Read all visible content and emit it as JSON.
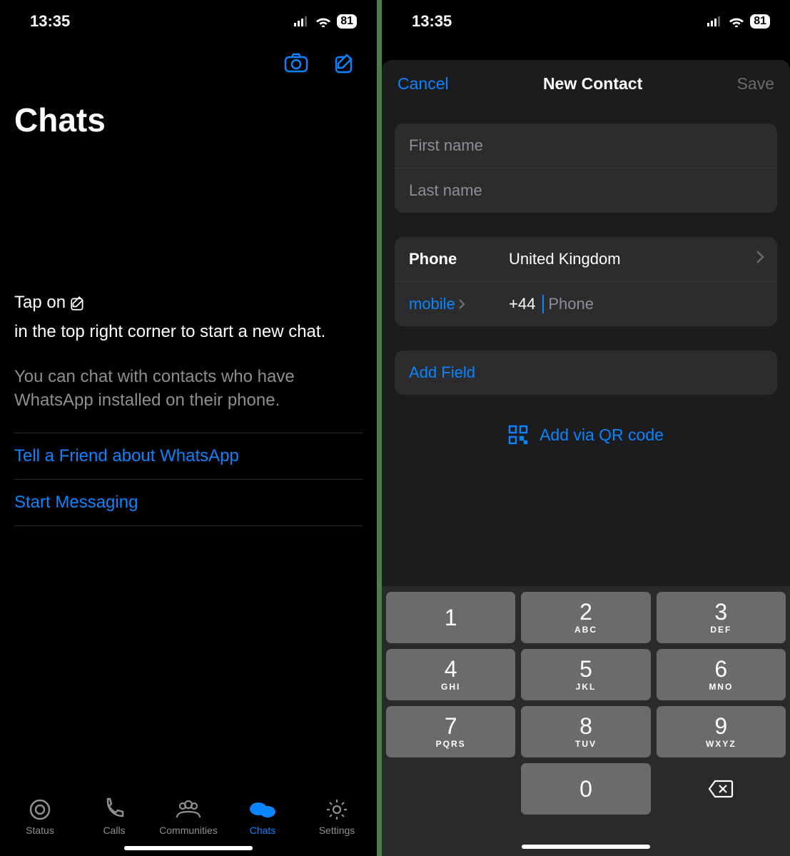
{
  "status": {
    "time": "13:35",
    "battery": "81"
  },
  "left": {
    "title": "Chats",
    "tip1_a": "Tap on",
    "tip1_b": "in the top right corner to start a new chat.",
    "tip2": "You can chat with contacts who have WhatsApp installed on their phone.",
    "link_tell": "Tell a Friend about WhatsApp",
    "link_start": "Start Messaging",
    "tabs": {
      "status": "Status",
      "calls": "Calls",
      "communities": "Communities",
      "chats": "Chats",
      "settings": "Settings"
    }
  },
  "right": {
    "cancel": "Cancel",
    "title": "New Contact",
    "save": "Save",
    "first_name_ph": "First name",
    "last_name_ph": "Last name",
    "phone_label": "Phone",
    "country": "United Kingdom",
    "mobile": "mobile",
    "dial": "+44",
    "phone_ph": "Phone",
    "add_field": "Add Field",
    "qr": "Add via QR code",
    "keys": [
      {
        "n": "1",
        "s": ""
      },
      {
        "n": "2",
        "s": "ABC"
      },
      {
        "n": "3",
        "s": "DEF"
      },
      {
        "n": "4",
        "s": "GHI"
      },
      {
        "n": "5",
        "s": "JKL"
      },
      {
        "n": "6",
        "s": "MNO"
      },
      {
        "n": "7",
        "s": "PQRS"
      },
      {
        "n": "8",
        "s": "TUV"
      },
      {
        "n": "9",
        "s": "WXYZ"
      },
      {
        "n": "",
        "s": ""
      },
      {
        "n": "0",
        "s": ""
      },
      {
        "n": "del",
        "s": ""
      }
    ]
  }
}
